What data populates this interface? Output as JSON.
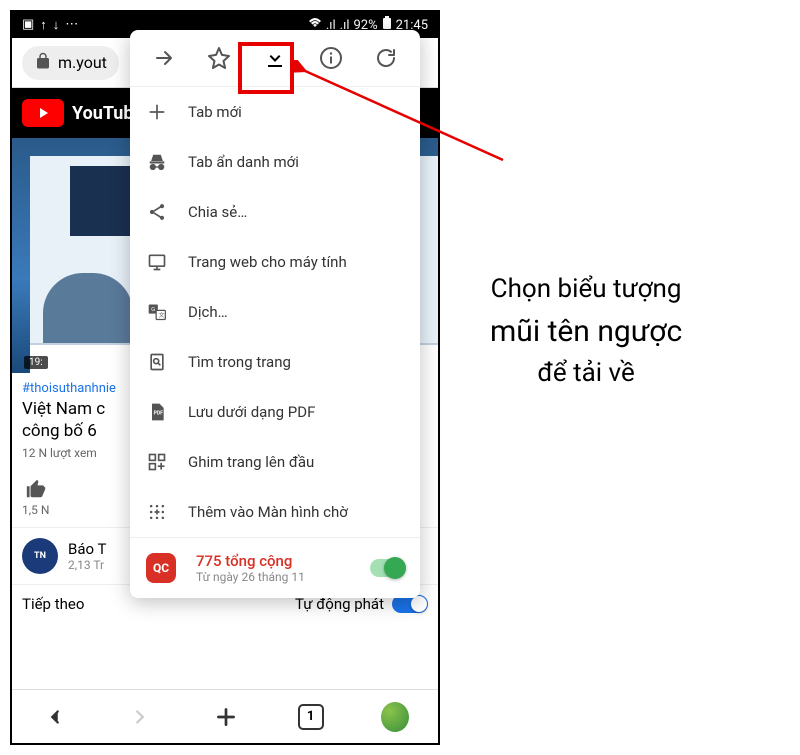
{
  "status": {
    "battery": "92%",
    "time": "21:45"
  },
  "url": {
    "text": "m.yout"
  },
  "youtube": {
    "brand": "YouTub"
  },
  "video": {
    "timestamp": "19:",
    "hashtag": "#thoisuthanhnie",
    "title_line1": "Việt Nam c",
    "title_line2": "công bố 6",
    "views": "12 N lượt xem",
    "likes": "1,5 N"
  },
  "channel": {
    "name": "Báo T",
    "subs": "2,13 Tr"
  },
  "next": {
    "label": "Tiếp theo",
    "autoplay": "Tự động phát"
  },
  "bottom": {
    "tabs": "1"
  },
  "menu": {
    "new_tab": "Tab mới",
    "incognito": "Tab ẩn danh mới",
    "share": "Chia sẻ…",
    "desktop": "Trang web cho máy tính",
    "translate": "Dịch…",
    "find": "Tìm trong trang",
    "save_pdf": "Lưu dưới dạng PDF",
    "pin": "Ghim trang lên đầu",
    "add_home": "Thêm vào Màn hình chờ",
    "qc_badge": "QC",
    "qc_count": "775 tổng cộng",
    "qc_date": "Từ ngày 26 tháng 11"
  },
  "annotation": {
    "line1": "Chọn biểu tượng",
    "line2": "mũi tên ngược",
    "line3": "để tải về"
  }
}
